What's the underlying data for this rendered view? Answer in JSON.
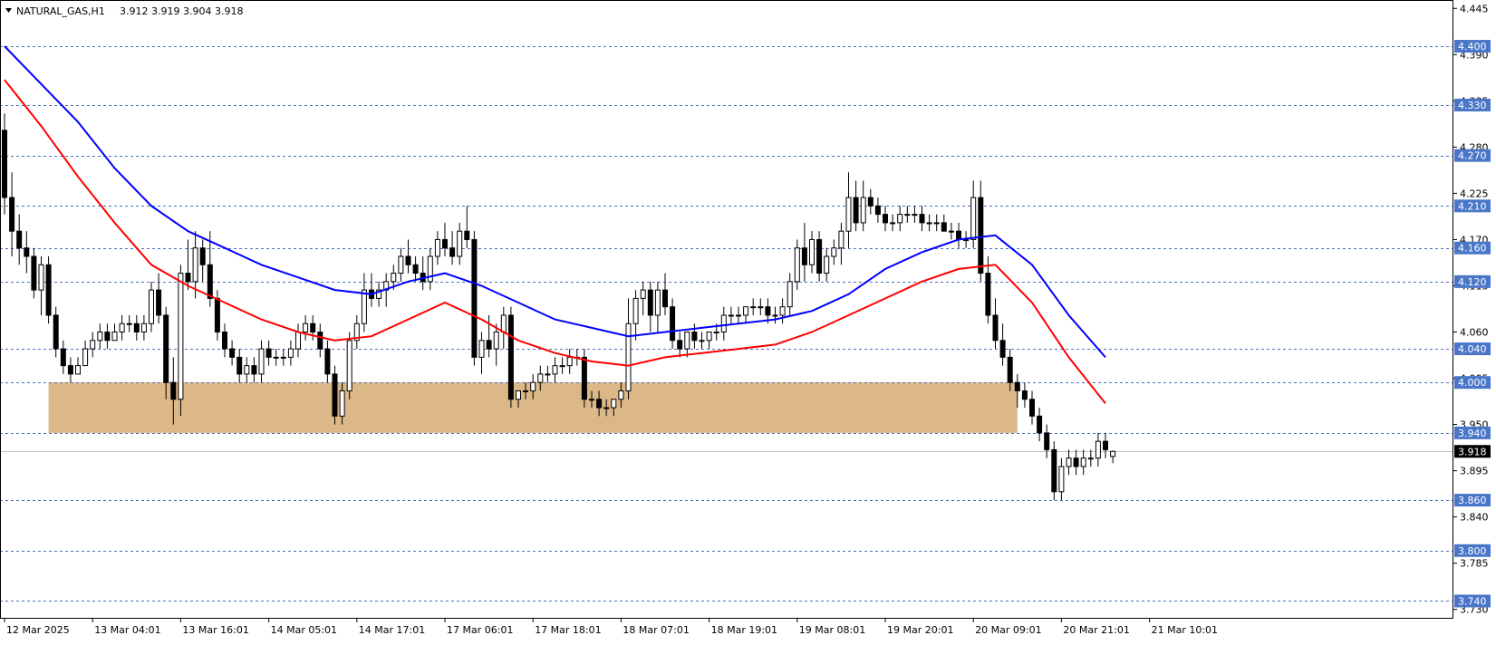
{
  "header": {
    "symbol": "NATURAL_GAS,H1",
    "ohlc": "3.912 3.919 3.904 3.918"
  },
  "chart_data": {
    "type": "candlestick",
    "symbol": "NATURAL_GAS",
    "timeframe": "H1",
    "ylim": [
      3.72,
      4.455
    ],
    "y_ticks": [
      "4.445",
      "4.390",
      "4.335",
      "4.280",
      "4.225",
      "4.170",
      "4.115",
      "4.060",
      "4.005",
      "3.950",
      "3.895",
      "3.840",
      "3.785",
      "3.730"
    ],
    "x_tick_labels": [
      "12 Mar 2025",
      "13 Mar 04:01",
      "13 Mar 16:01",
      "14 Mar 05:01",
      "14 Mar 17:01",
      "17 Mar 06:01",
      "17 Mar 18:01",
      "18 Mar 07:01",
      "18 Mar 19:01",
      "19 Mar 08:01",
      "19 Mar 20:01",
      "20 Mar 09:01",
      "20 Mar 21:01",
      "21 Mar 10:01"
    ],
    "levels": [
      {
        "value": 4.4,
        "label": "4.400"
      },
      {
        "value": 4.33,
        "label": "4.330"
      },
      {
        "value": 4.27,
        "label": "4.270"
      },
      {
        "value": 4.21,
        "label": "4.210"
      },
      {
        "value": 4.16,
        "label": "4.160"
      },
      {
        "value": 4.12,
        "label": "4.120"
      },
      {
        "value": 4.04,
        "label": "4.040"
      },
      {
        "value": 4.0,
        "label": "4.000"
      },
      {
        "value": 3.94,
        "label": "3.940"
      },
      {
        "value": 3.86,
        "label": "3.860"
      },
      {
        "value": 3.8,
        "label": "3.800"
      },
      {
        "value": 3.74,
        "label": "3.740"
      }
    ],
    "current_price": {
      "value": 3.918,
      "label": "3.918"
    },
    "zone": {
      "low": 3.94,
      "high": 4.0,
      "start_index": 6,
      "end_index": 138,
      "color": "#dcb787"
    },
    "colors": {
      "ma_fast": "#0000ff",
      "ma_slow": "#ff0000",
      "level_line": "#4a6fc0",
      "label_bg": "#4a76c8",
      "zone": "#dcb787"
    },
    "candles": [
      [
        4.3,
        4.32,
        4.2,
        4.22
      ],
      [
        4.22,
        4.25,
        4.15,
        4.18
      ],
      [
        4.18,
        4.2,
        4.14,
        4.16
      ],
      [
        4.16,
        4.18,
        4.13,
        4.15
      ],
      [
        4.15,
        4.16,
        4.1,
        4.11
      ],
      [
        4.11,
        4.15,
        4.08,
        4.14
      ],
      [
        4.14,
        4.15,
        4.07,
        4.08
      ],
      [
        4.08,
        4.09,
        4.03,
        4.04
      ],
      [
        4.04,
        4.05,
        4.01,
        4.02
      ],
      [
        4.02,
        4.03,
        4.0,
        4.01
      ],
      [
        4.01,
        4.03,
        4.01,
        4.02
      ],
      [
        4.02,
        4.05,
        4.02,
        4.04
      ],
      [
        4.04,
        4.06,
        4.03,
        4.05
      ],
      [
        4.05,
        4.07,
        4.04,
        4.06
      ],
      [
        4.06,
        4.07,
        4.04,
        4.05
      ],
      [
        4.05,
        4.07,
        4.05,
        4.06
      ],
      [
        4.06,
        4.08,
        4.05,
        4.07
      ],
      [
        4.07,
        4.08,
        4.06,
        4.07
      ],
      [
        4.07,
        4.08,
        4.05,
        4.06
      ],
      [
        4.06,
        4.08,
        4.05,
        4.07
      ],
      [
        4.07,
        4.12,
        4.06,
        4.11
      ],
      [
        4.11,
        4.13,
        4.07,
        4.08
      ],
      [
        4.08,
        4.09,
        3.98,
        4.0
      ],
      [
        4.0,
        4.03,
        3.95,
        3.98
      ],
      [
        3.98,
        4.14,
        3.96,
        4.13
      ],
      [
        4.13,
        4.17,
        4.11,
        4.12
      ],
      [
        4.12,
        4.18,
        4.1,
        4.16
      ],
      [
        4.16,
        4.17,
        4.12,
        4.14
      ],
      [
        4.14,
        4.18,
        4.09,
        4.1
      ],
      [
        4.1,
        4.11,
        4.05,
        4.06
      ],
      [
        4.06,
        4.07,
        4.03,
        4.04
      ],
      [
        4.04,
        4.05,
        4.02,
        4.03
      ],
      [
        4.03,
        4.04,
        4.0,
        4.01
      ],
      [
        4.01,
        4.03,
        4.0,
        4.02
      ],
      [
        4.02,
        4.03,
        4.0,
        4.01
      ],
      [
        4.01,
        4.05,
        4.0,
        4.04
      ],
      [
        4.04,
        4.05,
        4.02,
        4.03
      ],
      [
        4.03,
        4.04,
        4.02,
        4.03
      ],
      [
        4.03,
        4.04,
        4.02,
        4.03
      ],
      [
        4.03,
        4.05,
        4.02,
        4.04
      ],
      [
        4.04,
        4.07,
        4.03,
        4.06
      ],
      [
        4.06,
        4.08,
        4.05,
        4.07
      ],
      [
        4.07,
        4.08,
        4.05,
        4.06
      ],
      [
        4.06,
        4.07,
        4.03,
        4.04
      ],
      [
        4.04,
        4.05,
        4.0,
        4.01
      ],
      [
        4.01,
        4.02,
        3.95,
        3.96
      ],
      [
        3.96,
        4.0,
        3.95,
        3.99
      ],
      [
        3.99,
        4.06,
        3.98,
        4.05
      ],
      [
        4.05,
        4.08,
        4.04,
        4.07
      ],
      [
        4.07,
        4.13,
        4.06,
        4.11
      ],
      [
        4.11,
        4.13,
        4.09,
        4.1
      ],
      [
        4.1,
        4.12,
        4.09,
        4.11
      ],
      [
        4.11,
        4.13,
        4.09,
        4.12
      ],
      [
        4.12,
        4.14,
        4.11,
        4.13
      ],
      [
        4.13,
        4.16,
        4.12,
        4.15
      ],
      [
        4.15,
        4.17,
        4.13,
        4.14
      ],
      [
        4.14,
        4.15,
        4.12,
        4.13
      ],
      [
        4.13,
        4.15,
        4.11,
        4.12
      ],
      [
        4.12,
        4.16,
        4.11,
        4.15
      ],
      [
        4.15,
        4.18,
        4.14,
        4.17
      ],
      [
        4.17,
        4.19,
        4.15,
        4.16
      ],
      [
        4.16,
        4.18,
        4.14,
        4.15
      ],
      [
        4.15,
        4.19,
        4.14,
        4.18
      ],
      [
        4.18,
        4.21,
        4.16,
        4.17
      ],
      [
        4.17,
        4.18,
        4.02,
        4.03
      ],
      [
        4.03,
        4.06,
        4.01,
        4.05
      ],
      [
        4.05,
        4.08,
        4.03,
        4.04
      ],
      [
        4.04,
        4.07,
        4.02,
        4.06
      ],
      [
        4.06,
        4.09,
        4.04,
        4.08
      ],
      [
        4.08,
        4.09,
        3.97,
        3.98
      ],
      [
        3.98,
        3.99,
        3.97,
        3.99
      ],
      [
        3.99,
        4.0,
        3.98,
        3.99
      ],
      [
        3.99,
        4.01,
        3.98,
        4.0
      ],
      [
        4.0,
        4.02,
        3.99,
        4.01
      ],
      [
        4.01,
        4.02,
        4.0,
        4.01
      ],
      [
        4.01,
        4.03,
        4.0,
        4.02
      ],
      [
        4.02,
        4.03,
        4.01,
        4.02
      ],
      [
        4.02,
        4.04,
        4.01,
        4.03
      ],
      [
        4.03,
        4.04,
        4.02,
        4.03
      ],
      [
        4.03,
        4.04,
        3.97,
        3.98
      ],
      [
        3.98,
        3.99,
        3.97,
        3.98
      ],
      [
        3.98,
        3.99,
        3.96,
        3.97
      ],
      [
        3.97,
        3.98,
        3.96,
        3.97
      ],
      [
        3.97,
        3.98,
        3.96,
        3.98
      ],
      [
        3.98,
        4.0,
        3.97,
        3.99
      ],
      [
        3.99,
        4.1,
        3.98,
        4.07
      ],
      [
        4.07,
        4.11,
        4.05,
        4.1
      ],
      [
        4.1,
        4.12,
        4.08,
        4.11
      ],
      [
        4.11,
        4.12,
        4.06,
        4.08
      ],
      [
        4.08,
        4.12,
        4.06,
        4.11
      ],
      [
        4.11,
        4.13,
        4.08,
        4.09
      ],
      [
        4.09,
        4.1,
        4.04,
        4.05
      ],
      [
        4.05,
        4.06,
        4.03,
        4.04
      ],
      [
        4.04,
        4.06,
        4.03,
        4.06
      ],
      [
        4.06,
        4.07,
        4.04,
        4.05
      ],
      [
        4.05,
        4.06,
        4.04,
        4.05
      ],
      [
        4.05,
        4.06,
        4.04,
        4.06
      ],
      [
        4.06,
        4.07,
        4.05,
        4.06
      ],
      [
        4.06,
        4.09,
        4.05,
        4.08
      ],
      [
        4.08,
        4.09,
        4.07,
        4.08
      ],
      [
        4.08,
        4.09,
        4.07,
        4.08
      ],
      [
        4.08,
        4.09,
        4.07,
        4.09
      ],
      [
        4.09,
        4.1,
        4.08,
        4.09
      ],
      [
        4.09,
        4.1,
        4.08,
        4.09
      ],
      [
        4.09,
        4.1,
        4.07,
        4.08
      ],
      [
        4.08,
        4.09,
        4.07,
        4.08
      ],
      [
        4.08,
        4.1,
        4.07,
        4.09
      ],
      [
        4.09,
        4.13,
        4.08,
        4.12
      ],
      [
        4.12,
        4.17,
        4.11,
        4.16
      ],
      [
        4.16,
        4.19,
        4.12,
        4.14
      ],
      [
        4.14,
        4.18,
        4.13,
        4.17
      ],
      [
        4.17,
        4.18,
        4.12,
        4.13
      ],
      [
        4.13,
        4.16,
        4.12,
        4.15
      ],
      [
        4.15,
        4.17,
        4.14,
        4.16
      ],
      [
        4.16,
        4.19,
        4.14,
        4.18
      ],
      [
        4.18,
        4.25,
        4.16,
        4.22
      ],
      [
        4.22,
        4.24,
        4.18,
        4.19
      ],
      [
        4.19,
        4.24,
        4.18,
        4.22
      ],
      [
        4.22,
        4.23,
        4.2,
        4.21
      ],
      [
        4.21,
        4.22,
        4.19,
        4.2
      ],
      [
        4.2,
        4.21,
        4.18,
        4.19
      ],
      [
        4.19,
        4.2,
        4.18,
        4.19
      ],
      [
        4.19,
        4.21,
        4.18,
        4.2
      ],
      [
        4.2,
        4.21,
        4.19,
        4.2
      ],
      [
        4.2,
        4.21,
        4.19,
        4.2
      ],
      [
        4.2,
        4.21,
        4.18,
        4.19
      ],
      [
        4.19,
        4.2,
        4.18,
        4.19
      ],
      [
        4.19,
        4.2,
        4.18,
        4.19
      ],
      [
        4.19,
        4.2,
        4.18,
        4.18
      ],
      [
        4.18,
        4.19,
        4.17,
        4.18
      ],
      [
        4.18,
        4.19,
        4.16,
        4.17
      ],
      [
        4.17,
        4.18,
        4.16,
        4.17
      ],
      [
        4.17,
        4.24,
        4.16,
        4.22
      ],
      [
        4.22,
        4.24,
        4.12,
        4.13
      ],
      [
        4.13,
        4.15,
        4.07,
        4.08
      ],
      [
        4.08,
        4.1,
        4.04,
        4.05
      ],
      [
        4.05,
        4.07,
        4.02,
        4.03
      ],
      [
        4.03,
        4.04,
        3.99,
        4.0
      ],
      [
        4.0,
        4.01,
        3.97,
        3.99
      ],
      [
        3.99,
        4.0,
        3.97,
        3.98
      ],
      [
        3.98,
        3.99,
        3.95,
        3.96
      ],
      [
        3.96,
        3.97,
        3.93,
        3.94
      ],
      [
        3.94,
        3.95,
        3.91,
        3.92
      ],
      [
        3.92,
        3.93,
        3.86,
        3.87
      ],
      [
        3.87,
        3.91,
        3.86,
        3.9
      ],
      [
        3.9,
        3.92,
        3.89,
        3.91
      ],
      [
        3.91,
        3.92,
        3.89,
        3.9
      ],
      [
        3.9,
        3.92,
        3.89,
        3.91
      ],
      [
        3.91,
        3.92,
        3.9,
        3.91
      ],
      [
        3.91,
        3.94,
        3.9,
        3.93
      ],
      [
        3.93,
        3.94,
        3.91,
        3.92
      ],
      [
        3.912,
        3.919,
        3.904,
        3.918
      ]
    ],
    "ma_fast": [
      [
        0,
        4.4
      ],
      [
        5,
        4.355
      ],
      [
        10,
        4.31
      ],
      [
        15,
        4.255
      ],
      [
        20,
        4.21
      ],
      [
        25,
        4.18
      ],
      [
        30,
        4.16
      ],
      [
        35,
        4.14
      ],
      [
        40,
        4.125
      ],
      [
        45,
        4.11
      ],
      [
        50,
        4.105
      ],
      [
        55,
        4.12
      ],
      [
        60,
        4.13
      ],
      [
        65,
        4.115
      ],
      [
        70,
        4.095
      ],
      [
        75,
        4.075
      ],
      [
        80,
        4.065
      ],
      [
        85,
        4.055
      ],
      [
        90,
        4.06
      ],
      [
        95,
        4.065
      ],
      [
        100,
        4.07
      ],
      [
        105,
        4.075
      ],
      [
        110,
        4.085
      ],
      [
        115,
        4.105
      ],
      [
        120,
        4.135
      ],
      [
        125,
        4.155
      ],
      [
        130,
        4.17
      ],
      [
        135,
        4.175
      ],
      [
        140,
        4.14
      ],
      [
        145,
        4.08
      ],
      [
        150,
        4.03
      ]
    ],
    "ma_slow": [
      [
        0,
        4.36
      ],
      [
        5,
        4.305
      ],
      [
        10,
        4.245
      ],
      [
        15,
        4.19
      ],
      [
        20,
        4.14
      ],
      [
        25,
        4.115
      ],
      [
        30,
        4.095
      ],
      [
        35,
        4.075
      ],
      [
        40,
        4.06
      ],
      [
        45,
        4.05
      ],
      [
        50,
        4.055
      ],
      [
        55,
        4.075
      ],
      [
        60,
        4.095
      ],
      [
        65,
        4.075
      ],
      [
        70,
        4.05
      ],
      [
        75,
        4.035
      ],
      [
        80,
        4.025
      ],
      [
        85,
        4.02
      ],
      [
        90,
        4.03
      ],
      [
        95,
        4.035
      ],
      [
        100,
        4.04
      ],
      [
        105,
        4.045
      ],
      [
        110,
        4.06
      ],
      [
        115,
        4.08
      ],
      [
        120,
        4.1
      ],
      [
        125,
        4.12
      ],
      [
        130,
        4.135
      ],
      [
        135,
        4.14
      ],
      [
        140,
        4.095
      ],
      [
        145,
        4.03
      ],
      [
        150,
        3.975
      ]
    ]
  }
}
